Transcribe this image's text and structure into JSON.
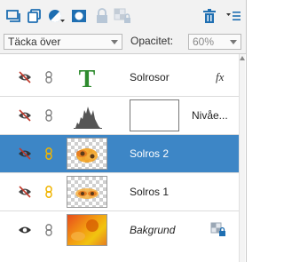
{
  "toolbar": {
    "icons": [
      "new-layer-icon",
      "new-group-icon",
      "adjustment-layer-icon",
      "layer-mask-icon",
      "lock-all-icon",
      "lock-transparency-icon",
      "delete-layer-icon",
      "panel-menu-icon"
    ]
  },
  "blend": {
    "mode_value": "Täcka över",
    "opacity_label": "Opacitet:",
    "opacity_value": "60%"
  },
  "layers": [
    {
      "name": "Solrosor",
      "type": "text",
      "visible": false,
      "selected": false,
      "fx_label": "fx"
    },
    {
      "name": "Nivåe...",
      "type": "adjustment",
      "visible": false,
      "selected": false
    },
    {
      "name": "Solros 2",
      "type": "image",
      "visible": false,
      "selected": true
    },
    {
      "name": "Solros 1",
      "type": "image",
      "visible": false,
      "selected": false
    },
    {
      "name": "Bakgrund",
      "type": "background",
      "visible": true,
      "selected": false
    }
  ],
  "colors": {
    "selected_row": "#3d86c6",
    "toolbar_blue": "#1f6fb2",
    "text_layer_green": "#2e8b2e"
  }
}
